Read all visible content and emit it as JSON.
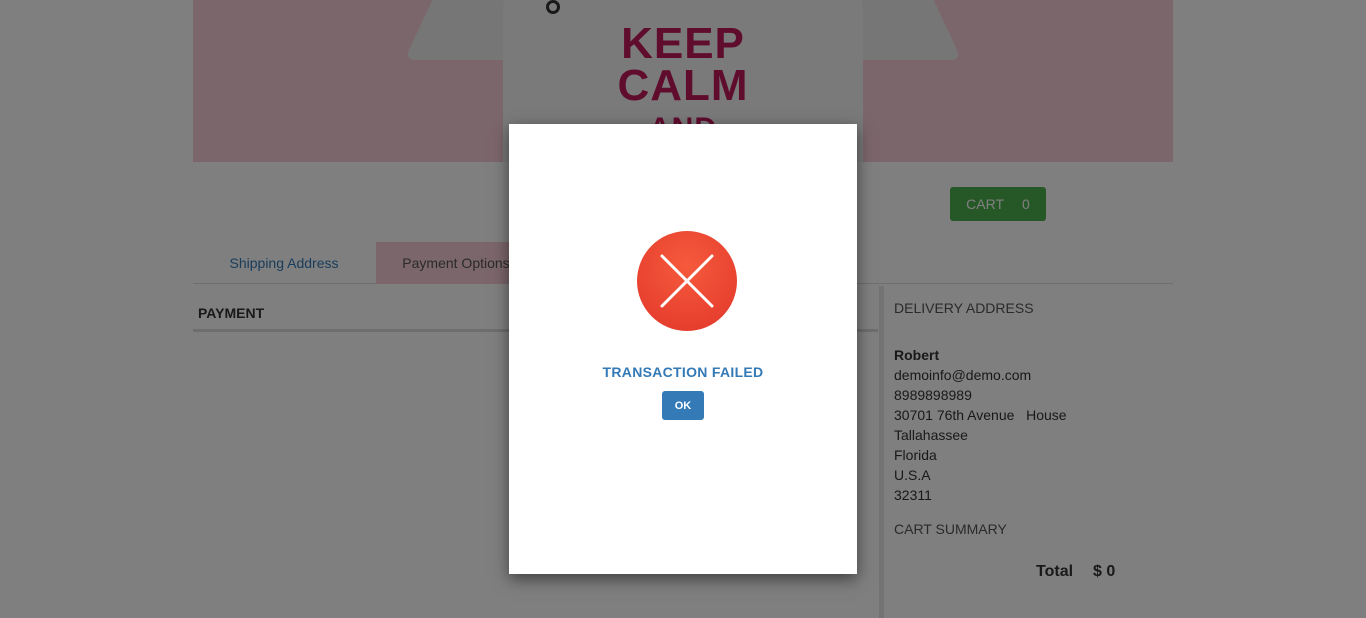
{
  "banner": {
    "slogan_line1": "KEEP",
    "slogan_line2": "CALM",
    "slogan_line3": "AND"
  },
  "header": {
    "cart_label": "CART",
    "cart_count": "0"
  },
  "tabs": [
    {
      "label": "Shipping Address"
    },
    {
      "label": "Payment Options"
    }
  ],
  "payment": {
    "title": "PAYMENT"
  },
  "delivery": {
    "title": "DELIVERY ADDRESS",
    "name": "Robert",
    "email": "demoinfo@demo.com",
    "phone": "8989898989",
    "street": "30701 76th Avenue   House",
    "city": "Tallahassee",
    "state": "Florida",
    "country": "U.S.A",
    "zip": "32311"
  },
  "summary": {
    "title": "CART SUMMARY",
    "total_label": "Total",
    "total_value": "$ 0"
  },
  "modal": {
    "title": "TRANSACTION FAILED",
    "ok_label": "OK",
    "icon": "close-icon"
  },
  "colors": {
    "accent_blue": "#337ab7",
    "success_green": "#4cae4c",
    "error_red": "#e2362a",
    "banner_pink": "#f7cdd6",
    "slogan_magenta": "#c0185a"
  }
}
